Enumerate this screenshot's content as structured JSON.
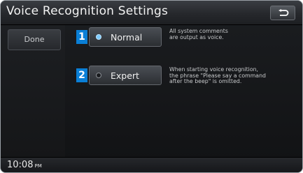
{
  "header": {
    "title": "Voice Recognition Settings",
    "back_icon": "back-arrow-icon"
  },
  "sidebar": {
    "done_label": "Done"
  },
  "options": [
    {
      "index": "1",
      "label": "Normal",
      "selected": true,
      "description": [
        "All system comments",
        "are output as voice."
      ]
    },
    {
      "index": "2",
      "label": "Expert",
      "selected": false,
      "description": [
        "When starting voice recognition,",
        "the phrase \"Please say a command",
        "after the beep\" is omitted."
      ]
    }
  ],
  "status": {
    "time": "10:08",
    "ampm": "PM"
  },
  "colors": {
    "accent": "#0a7fd6",
    "radio_on": "#7ecbff"
  }
}
